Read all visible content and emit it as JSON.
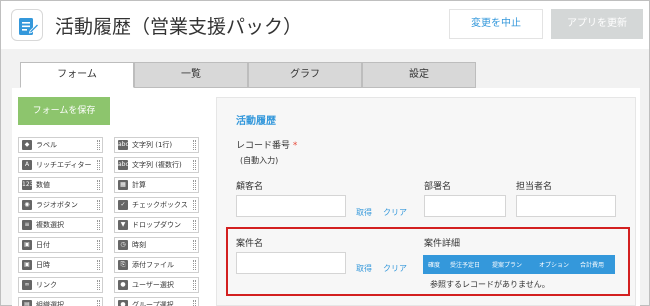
{
  "header": {
    "title": "活動履歴（営業支援パック）",
    "cancel_label": "変更を中止",
    "update_label": "アプリを更新"
  },
  "tabs": [
    {
      "label": "フォーム"
    },
    {
      "label": "一覧"
    },
    {
      "label": "グラフ"
    },
    {
      "label": "設定"
    }
  ],
  "palette": {
    "save_label": "フォームを保存",
    "items": [
      {
        "label": "ラベル",
        "icon": "label-icon",
        "glyph": "◆"
      },
      {
        "label": "文字列 (1行)",
        "icon": "text-single-icon",
        "glyph": "abc"
      },
      {
        "label": "リッチエディター",
        "icon": "rich-editor-icon",
        "glyph": "A"
      },
      {
        "label": "文字列 (複数行)",
        "icon": "text-multi-icon",
        "glyph": "abc"
      },
      {
        "label": "数値",
        "icon": "number-icon",
        "glyph": "123"
      },
      {
        "label": "計算",
        "icon": "calculator-icon",
        "glyph": "▦"
      },
      {
        "label": "ラジオボタン",
        "icon": "radio-icon",
        "glyph": "◉"
      },
      {
        "label": "チェックボックス",
        "icon": "checkbox-icon",
        "glyph": "✓"
      },
      {
        "label": "複数選択",
        "icon": "multi-select-icon",
        "glyph": "≡"
      },
      {
        "label": "ドロップダウン",
        "icon": "dropdown-icon",
        "glyph": "▼"
      },
      {
        "label": "日付",
        "icon": "date-icon",
        "glyph": "▣"
      },
      {
        "label": "時刻",
        "icon": "clock-icon",
        "glyph": "◷"
      },
      {
        "label": "日時",
        "icon": "datetime-icon",
        "glyph": "▣"
      },
      {
        "label": "添付ファイル",
        "icon": "attachment-icon",
        "glyph": "⎘"
      },
      {
        "label": "リンク",
        "icon": "link-icon",
        "glyph": "∞"
      },
      {
        "label": "ユーザー選択",
        "icon": "user-select-icon",
        "glyph": "●"
      },
      {
        "label": "組織選択",
        "icon": "org-select-icon",
        "glyph": "▤"
      },
      {
        "label": "グループ選択",
        "icon": "group-select-icon",
        "glyph": "●"
      }
    ]
  },
  "form": {
    "section_title": "活動履歴",
    "record_number_label": "レコード番号",
    "required_mark": "*",
    "auto_input": "(自動入力)",
    "customer_label": "顧客名",
    "department_label": "部署名",
    "person_label": "担当者名",
    "fetch_label": "取得",
    "clear_label": "クリア",
    "case_label": "案件名",
    "case_detail_label": "案件詳細",
    "related_columns": [
      "確度",
      "受注予定日",
      "提案プラン",
      "オプション",
      "合計費用"
    ],
    "related_empty": "参照するレコードがありません。"
  },
  "colors": {
    "accent": "#3498db",
    "save_button": "#8dc56d",
    "highlight": "#d32020",
    "required": "#e74c3c"
  }
}
